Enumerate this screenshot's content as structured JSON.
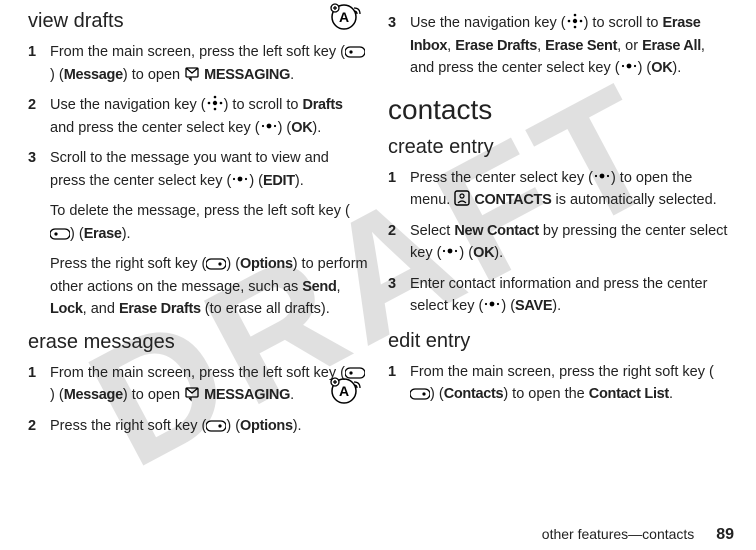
{
  "watermark": "DRAFT",
  "left": {
    "sec1": "view drafts",
    "s1_1a": "From the main screen, press the left soft key (",
    "s1_1b": ") (",
    "s1_1c": "Message",
    "s1_1d": ") to open ",
    "s1_1e": "MESSAGING",
    "s1_1f": ".",
    "s1_2a": "Use the navigation key (",
    "s1_2b": ") to scroll to ",
    "s1_2c": "Drafts",
    "s1_2d": " and press the center select key (",
    "s1_2e": ") (",
    "s1_2f": "OK",
    "s1_2g": ").",
    "s1_3a": "Scroll to the message you want to view and press the center select key (",
    "s1_3b": ") (",
    "s1_3c": "EDIT",
    "s1_3d": ").",
    "p1a": "To delete the message, press the left soft key (",
    "p1b": ") (",
    "p1c": "Erase",
    "p1d": ").",
    "p2a": "Press the right soft key (",
    "p2b": ") (",
    "p2c": "Options",
    "p2d": ") to perform other actions on the message, such as ",
    "p2e": "Send",
    "p2f": ", ",
    "p2g": "Lock",
    "p2h": ", and ",
    "p2i": "Erase Drafts",
    "p2j": " (to erase all drafts).",
    "sec2": "erase messages",
    "s2_1a": "From the main screen, press the left soft key (",
    "s2_1b": ") (",
    "s2_1c": "Message",
    "s2_1d": ") to open ",
    "s2_1e": "MESSAGING",
    "s2_1f": ".",
    "s2_2a": "Press the right soft key (",
    "s2_2b": ") (",
    "s2_2c": "Options",
    "s2_2d": ")."
  },
  "right": {
    "s0_3a": "Use the navigation key (",
    "s0_3b": ") to scroll to ",
    "s0_3c": "Erase Inbox",
    "s0_3d": ", ",
    "s0_3e": "Erase Drafts",
    "s0_3f": ", ",
    "s0_3g": "Erase Sent",
    "s0_3h": ", or ",
    "s0_3i": "Erase All",
    "s0_3j": ", and press the center select key (",
    "s0_3k": ") (",
    "s0_3l": "OK",
    "s0_3m": ").",
    "h1": "contacts",
    "sec1": "create entry",
    "s1_1a": "Press the center select key (",
    "s1_1b": ") to open the menu. ",
    "s1_1c": "CONTACTS",
    "s1_1d": " is automatically selected.",
    "s1_2a": "Select ",
    "s1_2b": "New Contact",
    "s1_2c": " by pressing the center select key (",
    "s1_2d": ") (",
    "s1_2e": "OK",
    "s1_2f": ").",
    "s1_3a": "Enter contact information and press the center select key (",
    "s1_3b": ") (",
    "s1_3c": "SAVE",
    "s1_3d": ").",
    "sec2": "edit entry",
    "s2_1a": "From the main screen, press the right soft key (",
    "s2_1b": ") (",
    "s2_1c": "Contacts",
    "s2_1d": ") to open the ",
    "s2_1e": "Contact List",
    "s2_1f": "."
  },
  "footer": {
    "chapter": "other features—contacts",
    "page": "89"
  }
}
